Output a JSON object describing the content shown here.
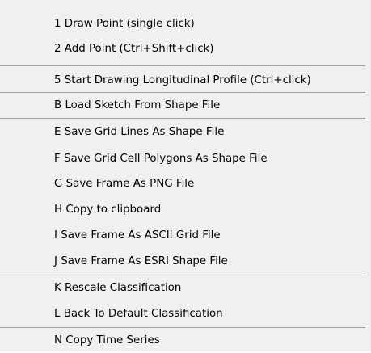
{
  "menu": {
    "items": [
      {
        "label": "1 Draw Point (single click)"
      },
      {
        "label": "2 Add Point (Ctrl+Shift+click)"
      },
      {
        "label": "5 Start Drawing Longitudinal Profile (Ctrl+click)"
      },
      {
        "label": "B Load Sketch From Shape File"
      },
      {
        "label": "E Save Grid Lines As Shape File"
      },
      {
        "label": "F Save Grid Cell Polygons As Shape File"
      },
      {
        "label": "G Save Frame As PNG File"
      },
      {
        "label": "H Copy to clipboard"
      },
      {
        "label": "I Save Frame As ASCII Grid File"
      },
      {
        "label": "J Save Frame As ESRI Shape File"
      },
      {
        "label": "K Rescale Classification"
      },
      {
        "label": "L Back To Default Classification"
      },
      {
        "label": "N Copy Time Series"
      }
    ]
  }
}
